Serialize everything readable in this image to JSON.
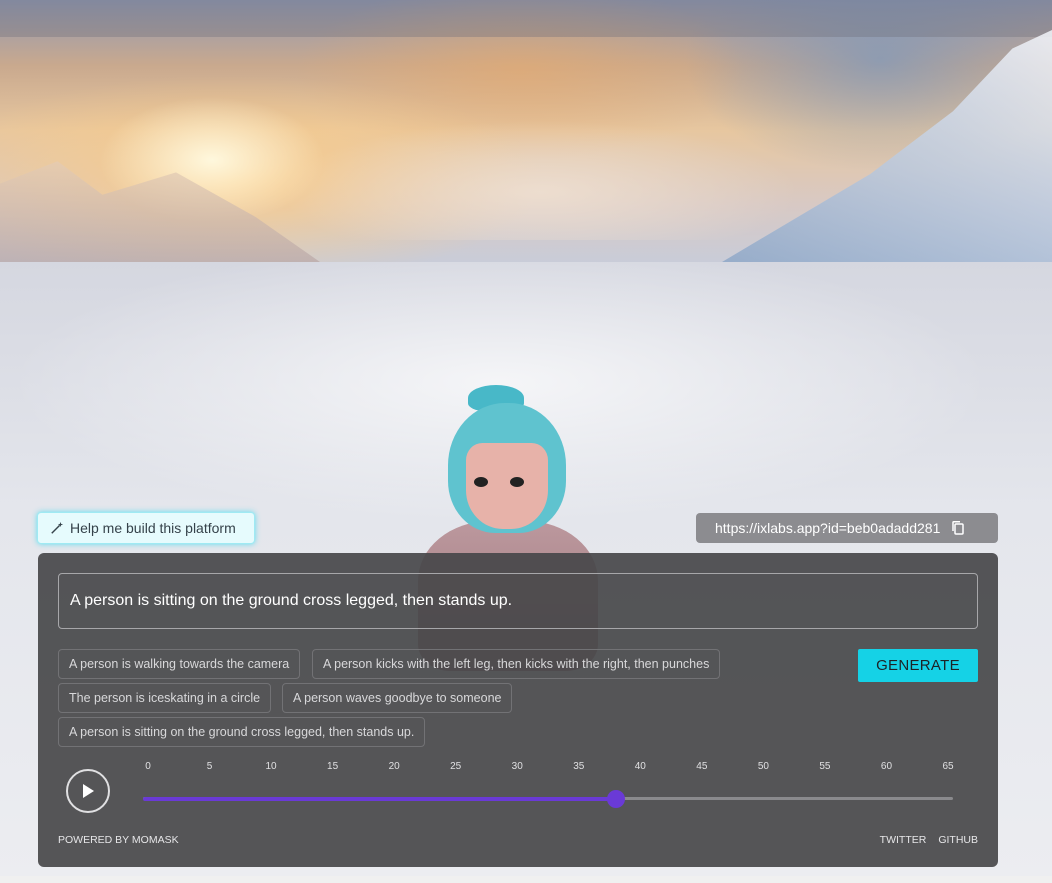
{
  "help_button": {
    "label": "Help me build this platform",
    "icon": "magic-wand-icon"
  },
  "share": {
    "url": "https://ixlabs.app?id=beb0adadd281",
    "icon": "copy-icon"
  },
  "prompt": {
    "value": "A person is sitting on the ground cross legged, then stands up."
  },
  "suggestions": [
    "A person is walking towards the camera",
    "A person kicks with the left leg, then kicks with the right, then punches",
    "The person is iceskating in a circle",
    "A person waves goodbye to someone",
    "A person is sitting on the ground cross legged, then stands up."
  ],
  "generate_label": "GENERATE",
  "timeline": {
    "ticks": [
      "0",
      "5",
      "10",
      "15",
      "20",
      "25",
      "30",
      "35",
      "40",
      "45",
      "50",
      "55",
      "60",
      "65"
    ],
    "min": 0,
    "max": 65,
    "value": 38
  },
  "footer": {
    "powered_by": "POWERED BY MOMASK",
    "twitter": "TWITTER",
    "github": "GITHUB"
  },
  "colors": {
    "accent": "#15d2e6",
    "slider": "#6a3ad6"
  }
}
